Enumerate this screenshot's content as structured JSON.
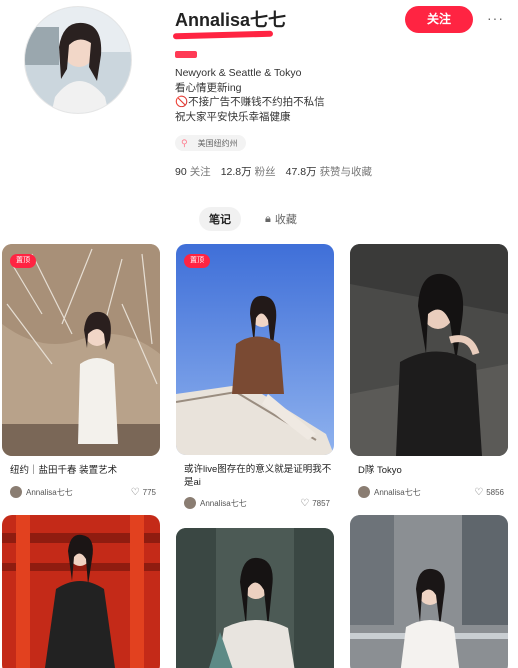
{
  "profile": {
    "name": "Annalisa七七",
    "follow_label": "关注",
    "more_label": "···",
    "bio_lines": [
      "Newyork & Seattle & Tokyo",
      "看心情更新ing",
      "🚫不接广告不赚钱不约拍不私信",
      "祝大家平安快乐幸福健康"
    ],
    "location_tag": "美国纽约州",
    "stats": {
      "following": "90",
      "following_label": "关注",
      "followers": "12.8万",
      "followers_label": "粉丝",
      "likes": "47.8万",
      "likes_label": "获赞与收藏"
    }
  },
  "tabs": [
    {
      "label": "笔记",
      "active": true
    },
    {
      "label": "收藏",
      "active": false
    }
  ],
  "notes": [
    {
      "pinned": "置顶",
      "title": "纽约｜盐田千春 装置艺术",
      "author": "Annalisa七七",
      "likes": "775"
    },
    {
      "pinned": "置顶",
      "title": "或许live图存在的意义就是证明我不是ai",
      "author": "Annalisa七七",
      "likes": "7857"
    },
    {
      "title": "D隊 Tokyo",
      "author": "Annalisa七七",
      "likes": "5856"
    }
  ],
  "colors": {
    "accent": "#ff2442"
  }
}
